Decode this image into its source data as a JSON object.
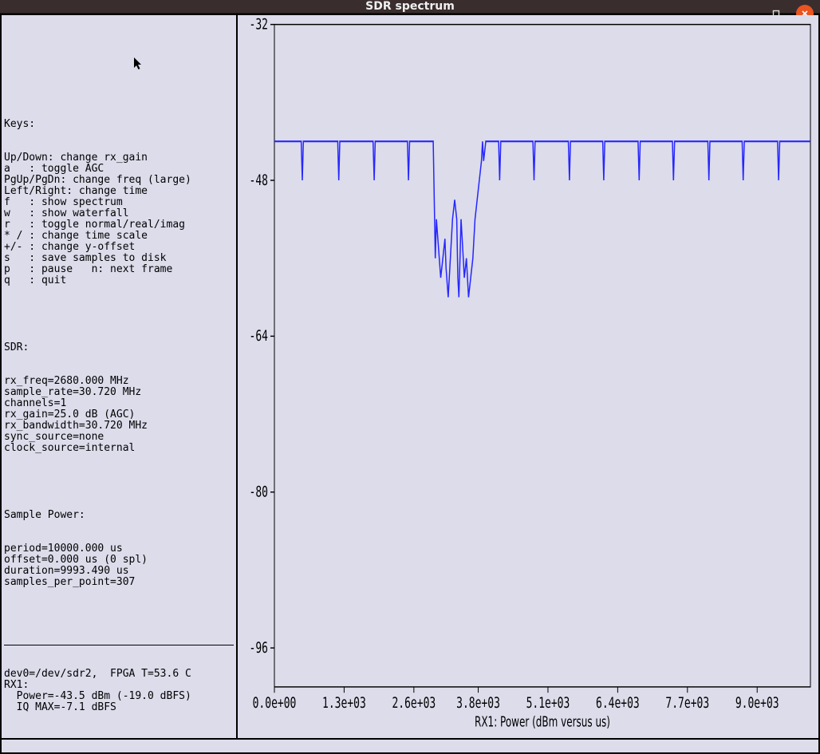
{
  "window": {
    "title": "SDR spectrum"
  },
  "sidebar": {
    "keys_header": "Keys:",
    "keys": [
      "Up/Down: change rx_gain",
      "a   : toggle AGC",
      "PgUp/PgDn: change freq (large)",
      "Left/Right: change time",
      "f   : show spectrum",
      "w   : show waterfall",
      "r   : toggle normal/real/imag",
      "* / : change time scale",
      "+/- : change y-offset",
      "s   : save samples to disk",
      "p   : pause   n: next frame",
      "q   : quit"
    ],
    "sdr_header": "SDR:",
    "sdr": [
      "rx_freq=2680.000 MHz",
      "sample_rate=30.720 MHz",
      "channels=1",
      "rx_gain=25.0 dB (AGC)",
      "rx_bandwidth=30.720 MHz",
      "sync_source=none",
      "clock_source=internal"
    ],
    "sample_header": "Sample Power:",
    "sample": [
      "period=10000.000 us",
      "offset=0.000 us (0 spl)",
      "duration=9993.490 us",
      "samples_per_point=307"
    ],
    "dev": [
      "dev0=/dev/sdr2,  FPGA T=53.6 C",
      "RX1:",
      "  Power=-43.5 dBm (-19.0 dBFS)",
      "  IQ MAX=-7.1 dBFS"
    ]
  },
  "chart_data": {
    "type": "line",
    "xlabel": "RX1: Power (dBm versus us)",
    "ylabel": "",
    "xlim": [
      0,
      9993
    ],
    "ylim": [
      -100,
      -32
    ],
    "xticks": [
      0,
      1300,
      2600,
      3800,
      5100,
      6400,
      7700,
      9000
    ],
    "xticklabels": [
      "0.0e+00",
      "1.3e+03",
      "2.6e+03",
      "3.8e+03",
      "5.1e+03",
      "6.4e+03",
      "7.7e+03",
      "9.0e+03"
    ],
    "yticks": [
      -32,
      -48,
      -64,
      -80,
      -96
    ],
    "series": [
      {
        "name": "RX1",
        "color": "#2727ff",
        "x": [
          0,
          300,
          500,
          520,
          540,
          700,
          900,
          1100,
          1180,
          1200,
          1220,
          1400,
          1700,
          1840,
          1860,
          1880,
          2000,
          2300,
          2480,
          2500,
          2520,
          2700,
          2900,
          2960,
          2980,
          3000,
          3020,
          3060,
          3100,
          3140,
          3180,
          3200,
          3240,
          3280,
          3320,
          3360,
          3400,
          3420,
          3440,
          3460,
          3480,
          3500,
          3540,
          3580,
          3620,
          3660,
          3700,
          3740,
          3780,
          3820,
          3860,
          3880,
          3900,
          3940,
          4000,
          4180,
          4200,
          4220,
          4400,
          4700,
          4820,
          4840,
          4860,
          5000,
          5300,
          5480,
          5500,
          5520,
          5700,
          6000,
          6120,
          6140,
          6160,
          6300,
          6600,
          6780,
          6800,
          6820,
          7000,
          7300,
          7420,
          7440,
          7460,
          7600,
          7900,
          8080,
          8100,
          8120,
          8300,
          8600,
          8720,
          8740,
          8760,
          8900,
          9200,
          9380,
          9400,
          9420,
          9600,
          9900,
          9993
        ],
        "y": [
          -44,
          -44,
          -44,
          -48,
          -44,
          -44,
          -44,
          -44,
          -44,
          -48,
          -44,
          -44,
          -44,
          -44,
          -48,
          -44,
          -44,
          -44,
          -44,
          -48,
          -44,
          -44,
          -44,
          -44,
          -50,
          -56,
          -52,
          -55,
          -58,
          -56,
          -54,
          -57,
          -60,
          -56,
          -52,
          -50,
          -52,
          -58,
          -60,
          -56,
          -52,
          -54,
          -58,
          -56,
          -60,
          -58,
          -56,
          -52,
          -50,
          -48,
          -46,
          -44,
          -46,
          -44,
          -44,
          -44,
          -48,
          -44,
          -44,
          -44,
          -44,
          -48,
          -44,
          -44,
          -44,
          -44,
          -48,
          -44,
          -44,
          -44,
          -44,
          -48,
          -44,
          -44,
          -44,
          -44,
          -48,
          -44,
          -44,
          -44,
          -44,
          -48,
          -44,
          -44,
          -44,
          -44,
          -48,
          -44,
          -44,
          -44,
          -44,
          -48,
          -44,
          -44,
          -44,
          -44,
          -48,
          -44,
          -44,
          -44,
          -44
        ]
      }
    ]
  }
}
